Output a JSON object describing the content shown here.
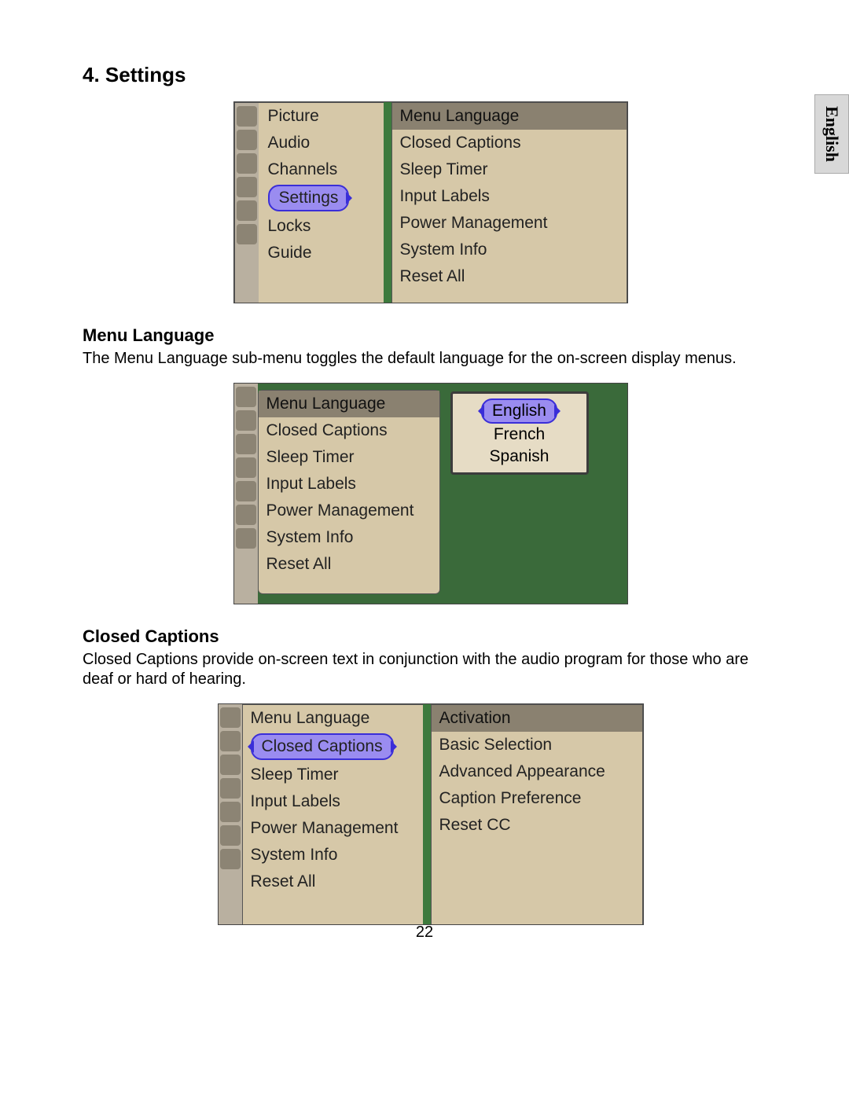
{
  "page_number": "22",
  "language_tab": "English",
  "section_title": "4. Settings",
  "subsection1_title": "Menu Language",
  "subsection1_body": "The Menu Language sub-menu toggles the default language for the on-screen display menus.",
  "subsection2_title": "Closed Captions",
  "subsection2_body": "Closed Captions provide on-screen text in conjunction with the audio program for those who are deaf or hard of hearing.",
  "shot1": {
    "main_menu": [
      "Picture",
      "Audio",
      "Channels",
      "Settings",
      "Locks",
      "Guide"
    ],
    "main_menu_selected": "Settings",
    "sub_menu_header": "Menu Language",
    "sub_menu": [
      "Closed Captions",
      "Sleep Timer",
      "Input Labels",
      "Power Management",
      "System Info",
      "Reset All"
    ]
  },
  "shot2": {
    "sub_menu_header": "Menu Language",
    "sub_menu": [
      "Closed Captions",
      "Sleep Timer",
      "Input Labels",
      "Power Management",
      "System Info",
      "Reset All"
    ],
    "popup_selected": "English",
    "popup_options": [
      "French",
      "Spanish"
    ]
  },
  "shot3": {
    "sub_menu": [
      "Menu Language",
      "Closed Captions",
      "Sleep Timer",
      "Input Labels",
      "Power Management",
      "System Info",
      "Reset All"
    ],
    "sub_menu_selected": "Closed Captions",
    "right_header": "Activation",
    "right_items": [
      "Basic Selection",
      "Advanced Appearance",
      "Caption Preference",
      "Reset CC"
    ]
  }
}
